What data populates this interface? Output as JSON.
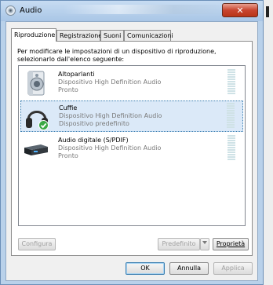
{
  "window": {
    "title": "Audio",
    "close_glyph": "✕"
  },
  "tabs": [
    {
      "label": "Riproduzione",
      "active": true
    },
    {
      "label": "Registrazione",
      "active": false
    },
    {
      "label": "Suoni",
      "active": false
    },
    {
      "label": "Comunicazioni",
      "active": false
    }
  ],
  "instructions": "Per modificare le impostazioni di un dispositivo di riproduzione, selezionarlo dall'elenco seguente:",
  "devices": [
    {
      "name": "Altoparlanti",
      "description": "Dispositivo High Definition Audio",
      "status": "Pronto",
      "icon": "speaker-icon",
      "selected": false
    },
    {
      "name": "Cuffie",
      "description": "Dispositivo High Definition Audio",
      "status": "Dispositivo predefinito",
      "icon": "headphones-icon",
      "selected": true,
      "default": true
    },
    {
      "name": "Audio digitale (S/PDIF)",
      "description": "Dispositivo High Definition Audio",
      "status": "Pronto",
      "icon": "digital-audio-device-icon",
      "selected": false
    }
  ],
  "buttons": {
    "configure": "Configura",
    "set_default": "Predefinito",
    "properties": "Proprietà",
    "ok": "OK",
    "cancel": "Annulla",
    "apply": "Applica"
  },
  "colors": {
    "selection": "#dbe9f8",
    "default_check": "#3aa845",
    "close_button": "#c8452f"
  }
}
